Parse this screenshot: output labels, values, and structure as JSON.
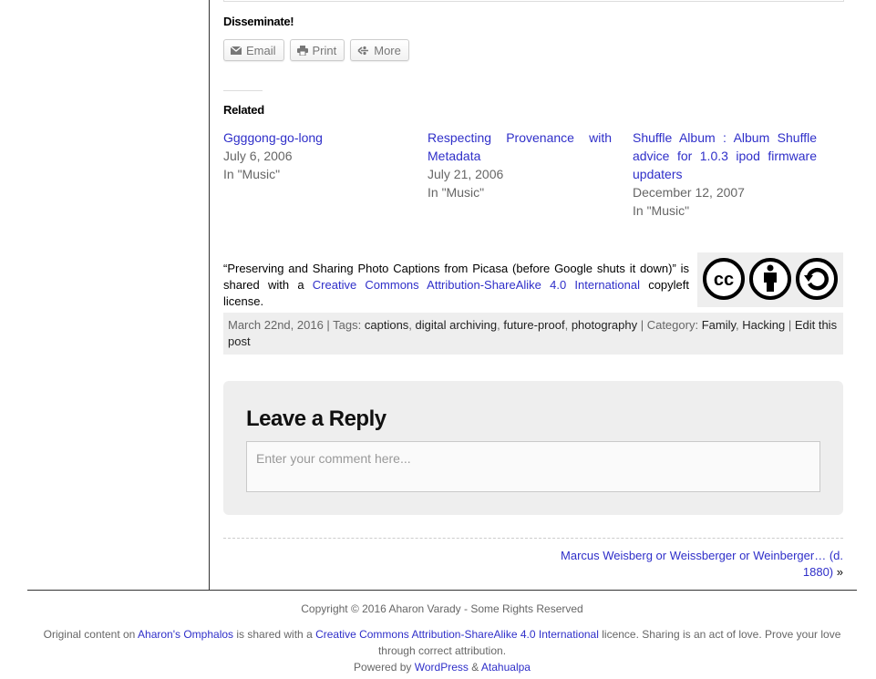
{
  "share": {
    "heading": "Disseminate!",
    "buttons": [
      {
        "label": "Email",
        "icon": "envelope-icon"
      },
      {
        "label": "Print",
        "icon": "printer-icon"
      },
      {
        "label": "More",
        "icon": "share-icon"
      }
    ]
  },
  "related": {
    "heading": "Related",
    "items": [
      {
        "title": "Ggggong-go-long",
        "date": "July 6, 2006",
        "category": "In \"Music\""
      },
      {
        "title": "Respecting Provenance with Metadata",
        "date": "July 21, 2006",
        "category": "In \"Music\""
      },
      {
        "title": "Shuffle Album : Album Shuffle advice for 1.0.3 ipod firmware updaters",
        "date": "December 12, 2007",
        "category": "In \"Music\""
      }
    ]
  },
  "license": {
    "post_title": "“Preserving and Sharing Photo Captions from Picasa (before Google shuts it down)”",
    "shared_with": " is shared with a ",
    "license_link": "Creative Commons Attribution-ShareAlike 4.0 International",
    "suffix": " copyleft license.",
    "badge_icons": [
      "cc-icon",
      "attribution-icon",
      "sharealike-icon"
    ]
  },
  "postmeta": {
    "date": "March 22nd, 2016",
    "tags_label": "Tags:",
    "tags": [
      "captions",
      "digital archiving",
      "future-proof",
      "photography"
    ],
    "category_label": "Category:",
    "categories": [
      "Family",
      "Hacking"
    ],
    "edit_label": "Edit this post"
  },
  "reply": {
    "title": "Leave a Reply",
    "placeholder": "Enter your comment here..."
  },
  "nav": {
    "next_post": "Marcus Weisberg or Weissberger or Weinberger… (d. 1880)",
    "arrow": "»"
  },
  "footer": {
    "copyright": "Copyright © 2016 Aharon Varady - Some Rights Reserved",
    "original_prefix": "Original content on ",
    "site_link": "Aharon's Omphalos",
    "shared_with": " is shared with a ",
    "license_link": "Creative Commons Attribution-ShareAlike 4.0 International",
    "licence_suffix": " licence. Sharing is an act of love. Prove your love through correct attribution.",
    "powered_by": "Powered by ",
    "wordpress": "WordPress",
    "amp": " & ",
    "theme": "Atahualpa"
  },
  "colors": {
    "link": "#2f2fc9",
    "panel_bg": "#eeeeee",
    "muted_text": "#666666"
  }
}
